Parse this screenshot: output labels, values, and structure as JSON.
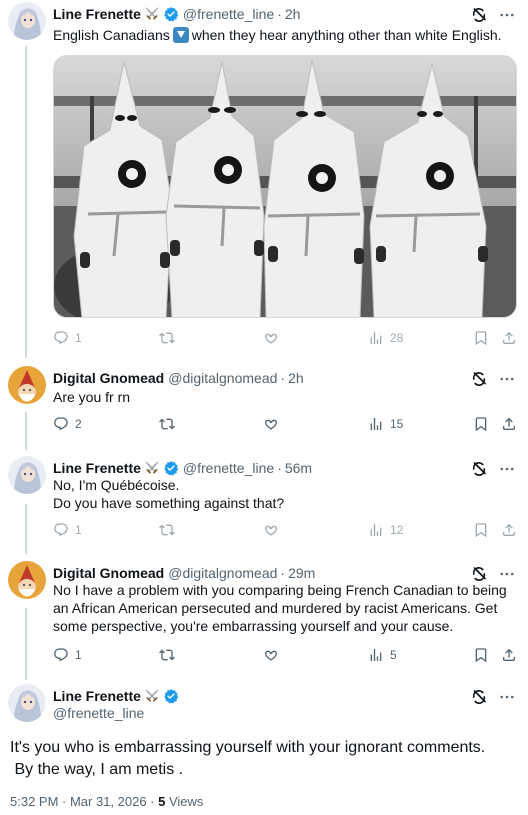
{
  "tweets": [
    {
      "name": "Line Frenette",
      "handle": "@frenette_line",
      "sep": "·",
      "time": "2h",
      "text_before": "English Canadians",
      "text_after": "when they hear anything other than white English.",
      "replies": "1",
      "retweets": "",
      "likes": "",
      "views": "28"
    },
    {
      "name": "Digital Gnomead",
      "handle": "@digitalgnomead",
      "sep": "·",
      "time": "2h",
      "lines": [
        "Are you fr rn"
      ],
      "replies": "2",
      "retweets": "",
      "likes": "",
      "views": "15"
    },
    {
      "name": "Line Frenette",
      "handle": "@frenette_line",
      "sep": "·",
      "time": "56m",
      "lines": [
        "No, I'm Québécoise.",
        "Do you have something against that?"
      ],
      "replies": "1",
      "retweets": "",
      "likes": "",
      "views": "12"
    },
    {
      "name": "Digital Gnomead",
      "handle": "@digitalgnomead",
      "sep": "·",
      "time": "29m",
      "lines": [
        "No I have a problem with you comparing being French Canadian to being an African American persecuted and murdered by racist Americans. Get some perspective, you're embarrassing yourself and your cause."
      ],
      "replies": "1",
      "retweets": "",
      "likes": "",
      "views": "5"
    }
  ],
  "main": {
    "name": "Line Frenette",
    "handle": "@frenette_line",
    "line1": "It's you who is embarrassing yourself with your ignorant comments.",
    "line2": " By the way, I am metis .",
    "timestamp": "5:32 PM · Mar 31, 2026 · ",
    "view_count": "5",
    "views_label": " Views"
  },
  "icons": {
    "reply": "reply-icon",
    "retweet": "retweet-icon",
    "like": "heart-icon",
    "views": "views-chart-icon",
    "bookmark": "bookmark-icon",
    "share": "share-icon",
    "grok": "grok-icon",
    "more": "more-icon",
    "verified": "verified-badge-icon",
    "swords": "crossed-swords-icon",
    "emoji": "down-arrow-emoji"
  },
  "colors": {
    "verified_blue": "#1d9bf0",
    "muted_text": "#536471",
    "thread_line": "#cfd9de"
  }
}
